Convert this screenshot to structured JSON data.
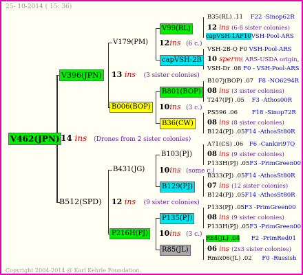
{
  "header": "25- 10-2014 ( 15: 36)",
  "footer": "Copyright 2004-2014 @ Karl Kehrle Foundation.",
  "root": {
    "label": "V462(JPN)",
    "num": "14",
    "ins": "ins",
    "note": "(Drones from 2 sister colonies)"
  },
  "gen1": {
    "upper": {
      "label": "V396(JPN)",
      "num": "13",
      "ins": "ins",
      "note": "(3 sister colonies)"
    },
    "lower": {
      "label": "B512(SPD)",
      "num": "12",
      "ins": "ins",
      "note": "(9 sister colonies)"
    }
  },
  "gen2": {
    "a": {
      "label": "V179(PM)",
      "num": "12",
      "ins": "ins",
      "note": "(6 c.)"
    },
    "b": {
      "label": "B006(BOP)",
      "num": "10",
      "ins": "ins",
      "note": "(3 c.)"
    },
    "c": {
      "label": "B431(JG)",
      "num": "10",
      "ins": "ins",
      "note": "(some c.)"
    },
    "d": {
      "label": "P216H(PJ)",
      "num": "10",
      "ins": "ins",
      "note": "(3 c.)"
    }
  },
  "gen3": {
    "a1": {
      "label": "V99(RL)"
    },
    "a2": {
      "label": "capVSH-2B"
    },
    "b1": {
      "label": "B801(BOP)"
    },
    "b2": {
      "label": "B36(CW)"
    },
    "c1": {
      "label": "B103(PJ)"
    },
    "c2": {
      "label": "B129(PJ)"
    },
    "d1": {
      "label": "P135(PJ)"
    },
    "d2": {
      "label": "R85(JL)"
    }
  },
  "gen4": {
    "a1": {
      "top": "B35(RL) .11",
      "top_src": "F22 -Sinop62R",
      "num": "12",
      "ins": "ins",
      "note": "(6-8 sister colonies)",
      "bot": "capVSH-1AF10",
      "bot_src": "VSH-Pool-ARS"
    },
    "a2": {
      "top": "VSH-2B-Q F0",
      "top_src": "VSH-Pool-ARS",
      "num": "10",
      "ins": "sperm",
      "note": "( ARS-USDA origin, sister",
      "bot": "VSH-Dr .08",
      "bot_src": "F0 - VSH-Pool-ARS"
    },
    "b1": {
      "top": "B107j(BOP) .07",
      "top_src": "F8 -NO6294R",
      "num": "08",
      "ins": "ins",
      "note": "(3 sister colonies)",
      "bot": "T247(PJ) .05",
      "bot_src": "F3 -Athos00R"
    },
    "b2": {
      "top": "PS596 .06",
      "top_src": "F18 -Sinop72R",
      "num": "08",
      "ins": "ins",
      "note": "(8 sister colonies)",
      "bot": "B124(PJ) .05",
      "bot_src": "F14 -AthosSt80R"
    },
    "c1": {
      "top": "A71(CS) .06",
      "top_src": "F6 -Cankiri97Q",
      "num": "08",
      "ins": "ins",
      "note": "(9 sister colonies)",
      "bot": "P133H(PJ) .05",
      "bot_src": "F3 -PrimGreen00"
    },
    "c2": {
      "top": "B333(PJ) .05",
      "top_src": "F14 -AthosSt80R",
      "num": "07",
      "ins": "ins",
      "note": "(12 sister colonies)",
      "bot": "B124(PJ) .05",
      "bot_src": "F14 -AthosSt80R"
    },
    "d1": {
      "top": "P133(PJ) .05",
      "top_src": "F3 -PrimGreen00",
      "num": "08",
      "ins": "ins",
      "note": "(9 sister colonies)",
      "bot": "P133H(PJ) .05",
      "bot_src": "F3 -PrimGreen00"
    },
    "d2": {
      "top": "R84(JL) .04",
      "top_src": "F2 -PrimRed01",
      "num": "06",
      "ins": "ins",
      "note": "(2x3 sister colonies)",
      "bot": "Rmix06(JL) .02",
      "bot_src": "F0 -Russish"
    }
  },
  "colors": {
    "border": "#e600b8",
    "green": "#00ee00",
    "cyan": "#00e5ee",
    "yellow": "#ffff00",
    "gray": "#aaaaaa",
    "ins": "#dd0000",
    "notes": "#6a1b9a",
    "source": "#0000cc"
  }
}
